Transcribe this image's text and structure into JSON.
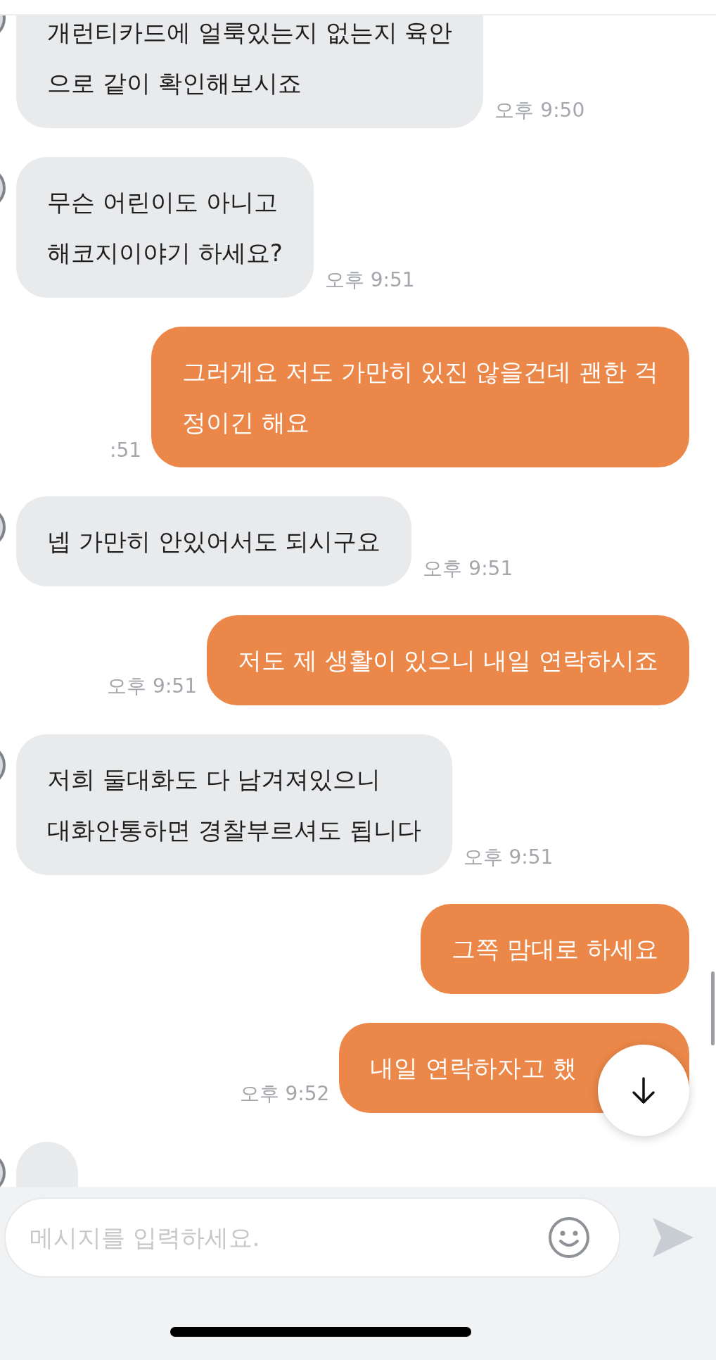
{
  "messages": [
    {
      "kind": "received",
      "lines": [
        "개런티카드에 얼룩있는지 없는지 육안",
        "으로 같이 확인해보시죠"
      ],
      "time": "오후 9:50"
    },
    {
      "kind": "received",
      "lines": [
        "무슨 어린이도 아니고",
        "해코지이야기 하세요?"
      ],
      "time": "오후 9:51"
    },
    {
      "kind": "sent",
      "lines": [
        "그러게요 저도 가만히 있진 않을건데 괜한 걱",
        "정이긴 해요"
      ],
      "time": ":51"
    },
    {
      "kind": "received",
      "lines": [
        "넵 가만히 안있어서도 되시구요"
      ],
      "time": "오후 9:51"
    },
    {
      "kind": "sent",
      "lines": [
        "저도 제 생활이 있으니 내일 연락하시죠"
      ],
      "time": "오후 9:51"
    },
    {
      "kind": "received",
      "lines": [
        "저희 둘대화도 다 남겨져있으니",
        "대화안통하면 경찰부르셔도 됩니다"
      ],
      "time": "오후 9:51"
    },
    {
      "kind": "sent",
      "lines": [
        "그쪽 맘대로 하세요"
      ]
    },
    {
      "kind": "sent",
      "lines": [
        "내일 연락하자고 했"
      ],
      "time": "오후 9:52",
      "covered": true
    },
    {
      "kind": "received"
    }
  ],
  "composer": {
    "placeholder": "메시지를 입력하세요."
  }
}
